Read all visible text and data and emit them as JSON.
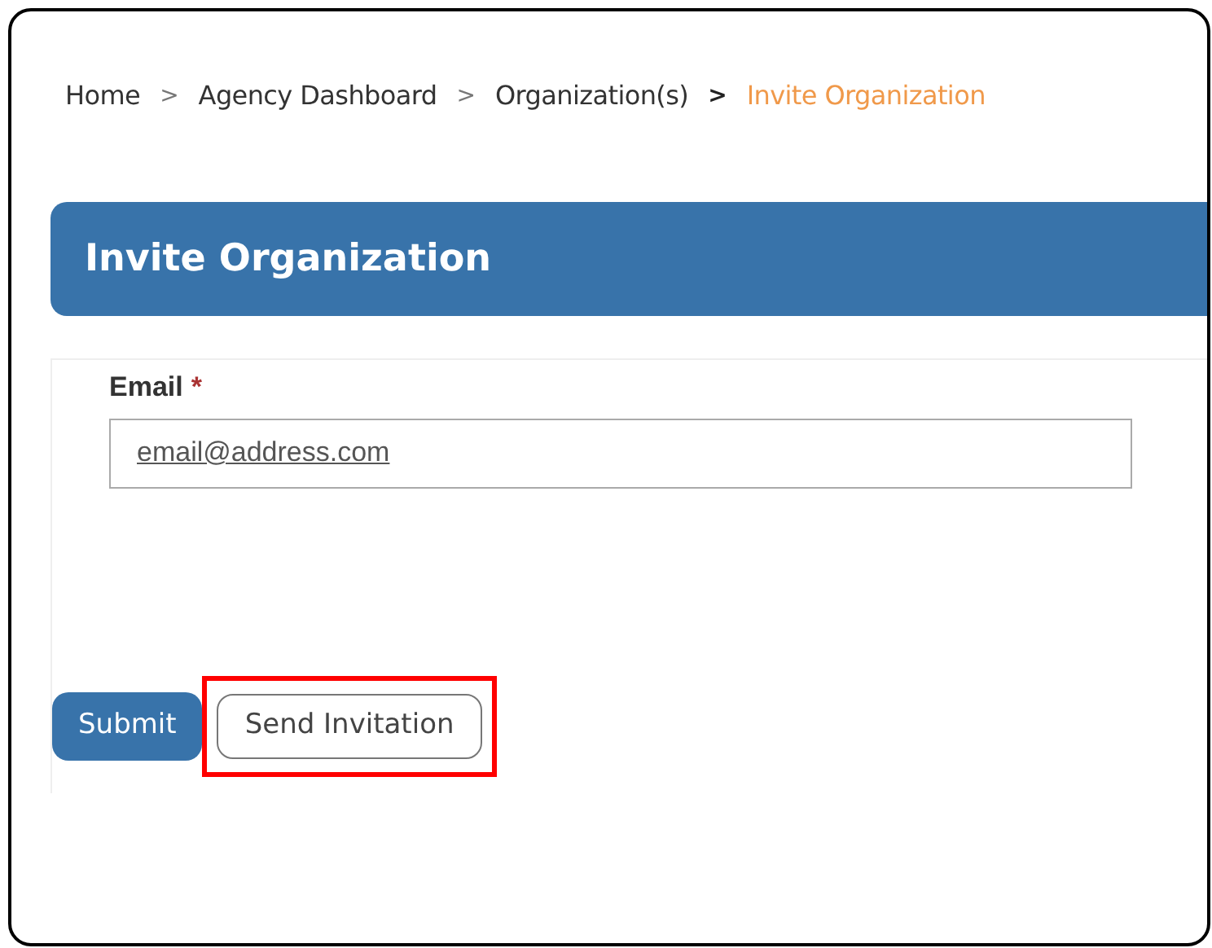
{
  "breadcrumb": [
    {
      "label": "Home",
      "current": false
    },
    {
      "separator": ">",
      "label": "Agency Dashboard",
      "current": false
    },
    {
      "separator": ">",
      "label": "Organization(s)",
      "current": false
    },
    {
      "separator": ">",
      "label": "Invite Organization",
      "current": true
    }
  ],
  "header": {
    "title": "Invite Organization"
  },
  "form": {
    "email": {
      "label": "Email",
      "required_mark": "*",
      "value": "email@address.com"
    }
  },
  "buttons": [
    {
      "label": "Submit",
      "kind": "primary",
      "highlighted": false
    },
    {
      "label": "Send Invitation",
      "kind": "outline",
      "highlighted": true
    }
  ]
}
